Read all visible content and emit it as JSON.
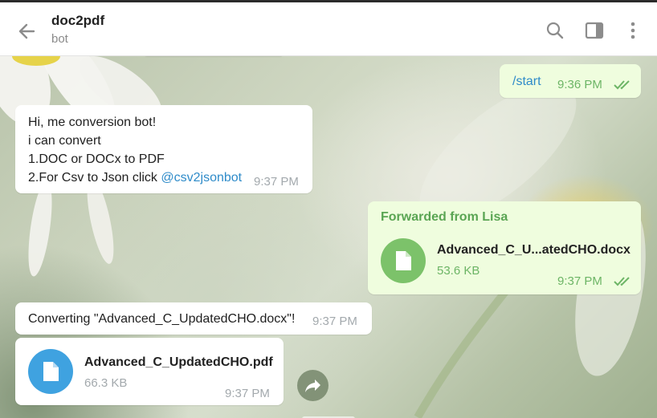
{
  "header": {
    "title": "doc2pdf",
    "subtitle": "bot"
  },
  "messages": {
    "start": {
      "text": "/start",
      "time": "9:36 PM"
    },
    "welcome": {
      "line1": "Hi, me conversion bot!",
      "line2": "i can convert",
      "line3": "1.DOC or DOCx to PDF",
      "line4_prefix": "2.For Csv to Json click ",
      "line4_link": "@csv2jsonbot",
      "time": "9:37 PM"
    },
    "forwarded": {
      "label": "Forwarded from Lisa",
      "file_name": "Advanced_C_U...atedCHO.docx",
      "file_size": "53.6 KB",
      "time": "9:37 PM"
    },
    "converting": {
      "text": "Converting \"Advanced_C_UpdatedCHO.docx\"!",
      "time": "9:37 PM"
    },
    "pdf_file": {
      "file_name": "Advanced_C_UpdatedCHO.pdf",
      "file_size": "66.3 KB",
      "time": "9:37 PM"
    }
  },
  "colors": {
    "outgoing_bubble": "#effdde",
    "incoming_bubble": "#ffffff",
    "outgoing_accent": "#6db566",
    "incoming_file_icon": "#3fa2e0",
    "link": "#2e8bc9"
  },
  "icons": {
    "back": "arrow-left-icon",
    "search": "search-icon",
    "sidebar": "sidebar-panel-icon",
    "menu": "more-vertical-icon",
    "file": "document-icon",
    "forward": "share-forward-icon",
    "read": "double-check-icon"
  }
}
